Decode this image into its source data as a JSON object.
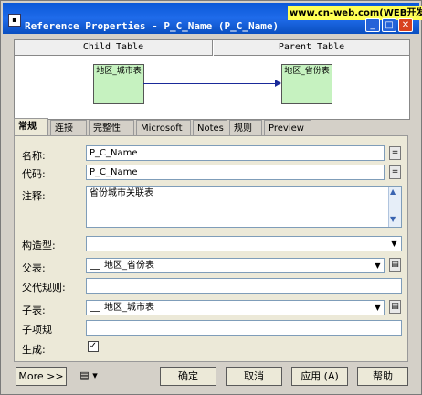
{
  "window": {
    "title": "Reference Properties - P_C_Name (P_C_Name)",
    "watermark": "www.cn-web.com(WEB开发技"
  },
  "diagram": {
    "child_table_header": "Child Table",
    "parent_table_header": "Parent Table",
    "child_entity": "地区_城市表",
    "parent_entity": "地区_省份表"
  },
  "tabs": [
    {
      "label": "常规"
    },
    {
      "label": "连接"
    },
    {
      "label": "完整性"
    },
    {
      "label": "Microsoft"
    },
    {
      "label": "Notes"
    },
    {
      "label": "规则"
    },
    {
      "label": "Preview"
    }
  ],
  "form": {
    "name_label": "名称:",
    "name_value": "P_C_Name",
    "code_label": "代码:",
    "code_value": "P_C_Name",
    "comment_label": "注释:",
    "comment_value": "省份城市关联表",
    "stereotype_label": "构造型:",
    "stereotype_value": "",
    "parent_label": "父表:",
    "parent_value": "地区_省份表",
    "parent_role_label": "父代规则:",
    "parent_role_value": "",
    "child_label": "子表:",
    "child_value": "地区_城市表",
    "child_role_label": "子项规",
    "child_role_value": "",
    "generate_label": "生成:",
    "generate_checked": true,
    "equals_symbol": "=",
    "checkmark_symbol": "✓"
  },
  "buttons": {
    "more": "More >>",
    "ok": "确定",
    "cancel": "取消",
    "apply": "应用 (A)",
    "help": "帮助"
  }
}
